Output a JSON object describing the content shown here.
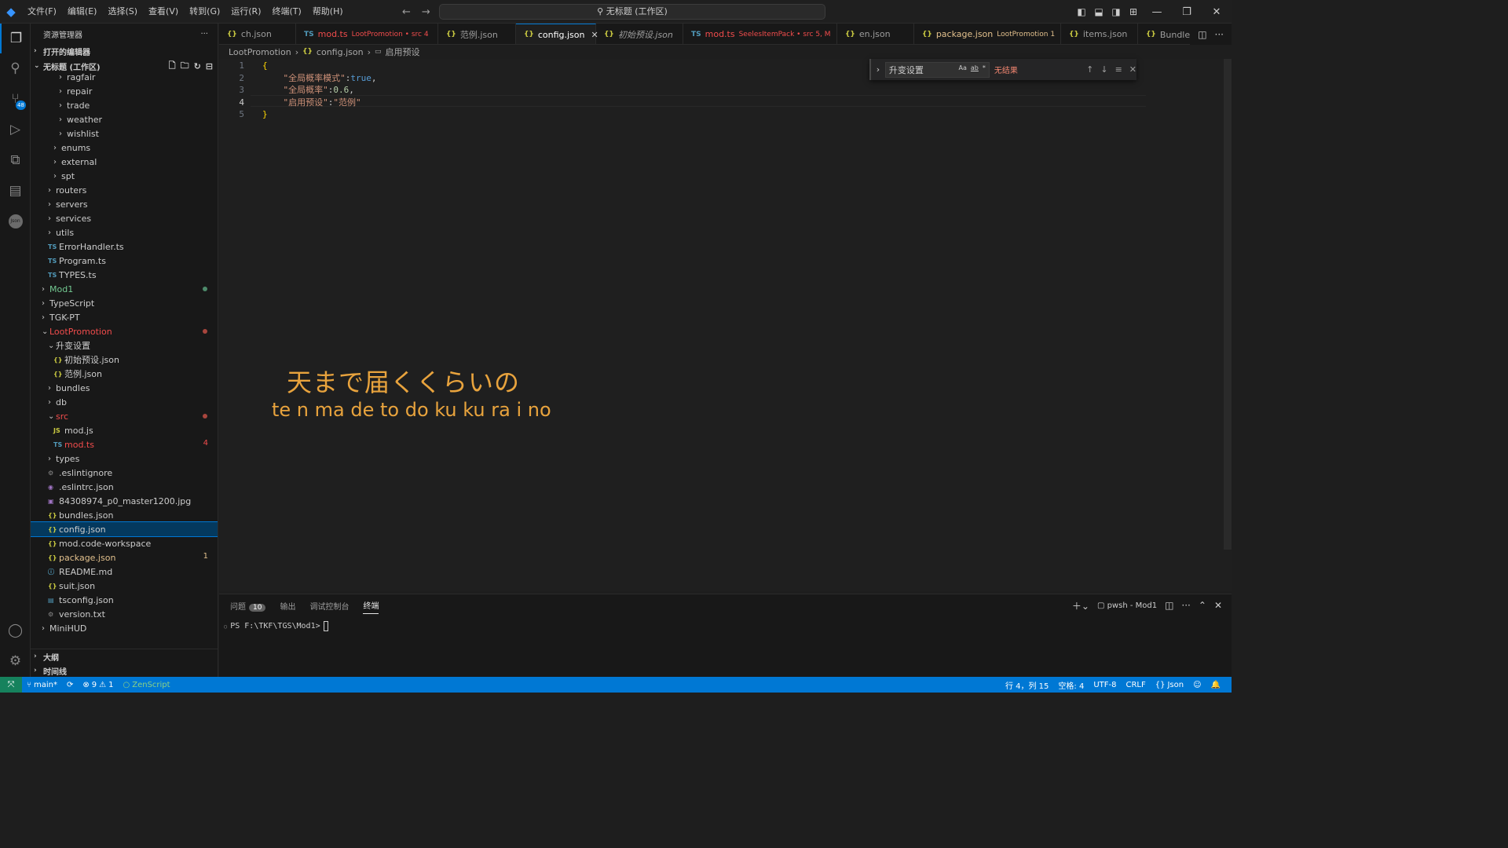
{
  "titlebar": {
    "menus": [
      "文件(F)",
      "编辑(E)",
      "选择(S)",
      "查看(V)",
      "转到(G)",
      "运行(R)",
      "终端(T)",
      "帮助(H)"
    ],
    "search": "无标题 (工作区)"
  },
  "sidebar": {
    "title": "资源管理器",
    "open_editors": "打开的编辑器",
    "workspace": "无标题 (工作区)",
    "outline": "大纲",
    "timeline": "时间线"
  },
  "tree": [
    {
      "label": "ragfair",
      "type": "folder",
      "indent": 36
    },
    {
      "label": "repair",
      "type": "folder",
      "indent": 36
    },
    {
      "label": "trade",
      "type": "folder",
      "indent": 36
    },
    {
      "label": "weather",
      "type": "folder",
      "indent": 36
    },
    {
      "label": "wishlist",
      "type": "folder",
      "indent": 36
    },
    {
      "label": "enums",
      "type": "folder",
      "indent": 29
    },
    {
      "label": "external",
      "type": "folder",
      "indent": 29
    },
    {
      "label": "spt",
      "type": "folder",
      "indent": 29
    },
    {
      "label": "routers",
      "type": "folder",
      "indent": 22
    },
    {
      "label": "servers",
      "type": "folder",
      "indent": 22
    },
    {
      "label": "services",
      "type": "folder",
      "indent": 22
    },
    {
      "label": "utils",
      "type": "folder",
      "indent": 22
    },
    {
      "label": "ErrorHandler.ts",
      "type": "ts",
      "indent": 22
    },
    {
      "label": "Program.ts",
      "type": "ts",
      "indent": 22
    },
    {
      "label": "TYPES.ts",
      "type": "ts",
      "indent": 22
    },
    {
      "label": "Mod1",
      "type": "folder",
      "indent": 14,
      "color": "green",
      "dot": "#4d8a6a"
    },
    {
      "label": "TypeScript",
      "type": "folder",
      "indent": 14
    },
    {
      "label": "TGK-PT",
      "type": "folder",
      "indent": 14
    },
    {
      "label": "LootPromotion",
      "type": "folder-open",
      "indent": 14,
      "color": "red",
      "dot": "#a8453d"
    },
    {
      "label": "升变设置",
      "type": "folder-open",
      "indent": 22
    },
    {
      "label": "初始预设.json",
      "type": "json",
      "indent": 29
    },
    {
      "label": "范例.json",
      "type": "json",
      "indent": 29
    },
    {
      "label": "bundles",
      "type": "folder",
      "indent": 22
    },
    {
      "label": "db",
      "type": "folder",
      "indent": 22
    },
    {
      "label": "src",
      "type": "folder-open",
      "indent": 22,
      "color": "red",
      "dot": "#a8453d"
    },
    {
      "label": "mod.js",
      "type": "js",
      "indent": 29
    },
    {
      "label": "mod.ts",
      "type": "ts",
      "indent": 29,
      "color": "red",
      "count": "4"
    },
    {
      "label": "types",
      "type": "folder",
      "indent": 22
    },
    {
      "label": ".eslintignore",
      "type": "gear",
      "indent": 22
    },
    {
      "label": ".eslintrc.json",
      "type": "eslint",
      "indent": 22
    },
    {
      "label": "84308974_p0_master1200.jpg",
      "type": "img",
      "indent": 22
    },
    {
      "label": "bundles.json",
      "type": "json",
      "indent": 22
    },
    {
      "label": "config.json",
      "type": "json",
      "indent": 22,
      "selected": true
    },
    {
      "label": "mod.code-workspace",
      "type": "json",
      "indent": 22
    },
    {
      "label": "package.json",
      "type": "json",
      "indent": 22,
      "color": "yellow",
      "count": "1"
    },
    {
      "label": "README.md",
      "type": "info",
      "indent": 22
    },
    {
      "label": "suit.json",
      "type": "json",
      "indent": 22
    },
    {
      "label": "tsconfig.json",
      "type": "tsconfig",
      "indent": 22
    },
    {
      "label": "version.txt",
      "type": "gear",
      "indent": 22
    },
    {
      "label": "MiniHUD",
      "type": "folder",
      "indent": 14
    }
  ],
  "tabs": [
    {
      "name": "ch.json",
      "icon": "json",
      "desc": "",
      "w": 98
    },
    {
      "name": "mod.ts",
      "icon": "ts",
      "desc": "LootPromotion • src 4",
      "w": 181,
      "color": "red"
    },
    {
      "name": "范例.json",
      "icon": "json",
      "desc": "",
      "w": 99
    },
    {
      "name": "config.json",
      "icon": "json",
      "desc": "",
      "w": 102,
      "active": true
    },
    {
      "name": "初始预设.json",
      "icon": "json",
      "desc": "",
      "w": 111,
      "italic": true
    },
    {
      "name": "mod.ts",
      "icon": "ts",
      "desc": "SeelesItemPack • src 5, M",
      "w": 196,
      "color": "red"
    },
    {
      "name": "en.json",
      "icon": "json",
      "desc": "",
      "w": 98
    },
    {
      "name": "package.json",
      "icon": "json",
      "desc": "LootPromotion 1",
      "w": 187,
      "color": "yellow"
    },
    {
      "name": "items.json",
      "icon": "json",
      "desc": "",
      "w": 98
    },
    {
      "name": "Bundle索",
      "icon": "json",
      "desc": "",
      "w": 90
    }
  ],
  "breadcrumb": [
    "LootPromotion",
    "config.json",
    "启用预设"
  ],
  "editor": {
    "lines": [
      {
        "n": "1",
        "parts": [
          [
            "br",
            "{"
          ]
        ]
      },
      {
        "n": "2",
        "parts": [
          [
            "p",
            "    "
          ],
          [
            "k",
            "\"全局概率模式\""
          ],
          [
            "p",
            ":"
          ],
          [
            "b",
            "true"
          ],
          [
            "p",
            ","
          ]
        ]
      },
      {
        "n": "3",
        "parts": [
          [
            "p",
            "    "
          ],
          [
            "k",
            "\"全局概率\""
          ],
          [
            "p",
            ":"
          ],
          [
            "n",
            "0.6"
          ],
          [
            "p",
            ","
          ]
        ]
      },
      {
        "n": "4",
        "parts": [
          [
            "p",
            "    "
          ],
          [
            "k",
            "\"启用预设\""
          ],
          [
            "p",
            ":"
          ],
          [
            "k",
            "\"范例\""
          ]
        ],
        "current": true
      },
      {
        "n": "5",
        "parts": [
          [
            "br",
            "}"
          ]
        ]
      }
    ]
  },
  "find": {
    "query": "升变设置",
    "result": "无结果",
    "options": [
      "Aa",
      "ab",
      "*"
    ]
  },
  "overlay": {
    "lyric_jp": "天まで届くくらいの",
    "lyric_romaji": "te n ma de to do ku ku ra i no",
    "color": "#e8a33d"
  },
  "panel": {
    "tabs": [
      "问题",
      "输出",
      "调试控制台",
      "终端"
    ],
    "problems_count": "10",
    "terminal_name": "pwsh - Mod1",
    "prompt": "PS F:\\TKF\\TGS\\Mod1>"
  },
  "statusbar": {
    "branch": "main*",
    "errors": "9",
    "warnings": "1",
    "ext": "ZenScript",
    "position": "行 4，列 15",
    "spaces": "空格: 4",
    "encoding": "UTF-8",
    "eol": "CRLF",
    "language": "Json"
  }
}
